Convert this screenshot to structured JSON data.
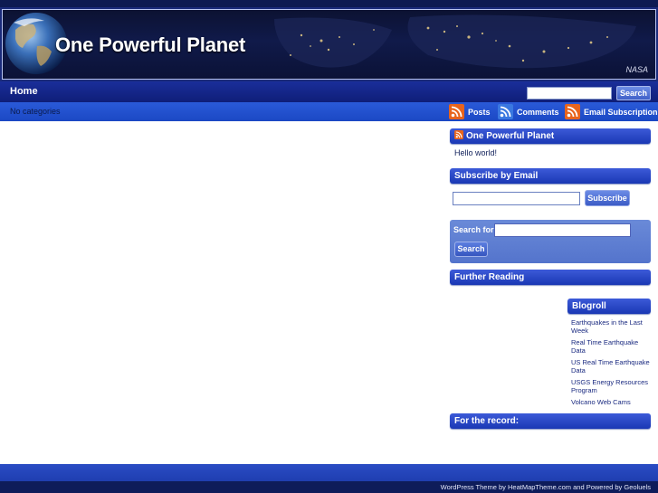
{
  "header": {
    "site_title": "One Powerful Planet",
    "image_credit": "NASA"
  },
  "nav": {
    "home_label": "Home",
    "search_button": "Search"
  },
  "category_bar": {
    "no_categories": "No categories",
    "feeds": {
      "posts": "Posts",
      "comments": "Comments",
      "email": "Email Subscription"
    }
  },
  "sidebar": {
    "latest_widget": {
      "title": "One Powerful Planet",
      "post_link": "Hello world!"
    },
    "subscribe_widget": {
      "title": "Subscribe by Email",
      "button": "Subscribe"
    },
    "search_widget": {
      "label": "Search for:",
      "button": "Search"
    },
    "further_reading_title": "Further Reading",
    "blogroll": {
      "title": "Blogroll",
      "links": [
        "Earthquakes in the Last Week",
        "Real Time Earthquake Data",
        "US Real Time Earthquake Data",
        "USGS Energy Resources Program",
        "Volcano Web Cams"
      ]
    },
    "record_title": "For the record:"
  },
  "footer": {
    "credit": "WordPress Theme by HeatMapTheme.com and Powered by Geoluels"
  },
  "colors": {
    "nav_blue": "#0f1e78",
    "bar_blue": "#1b48c4",
    "rss_orange": "#e8641c"
  }
}
